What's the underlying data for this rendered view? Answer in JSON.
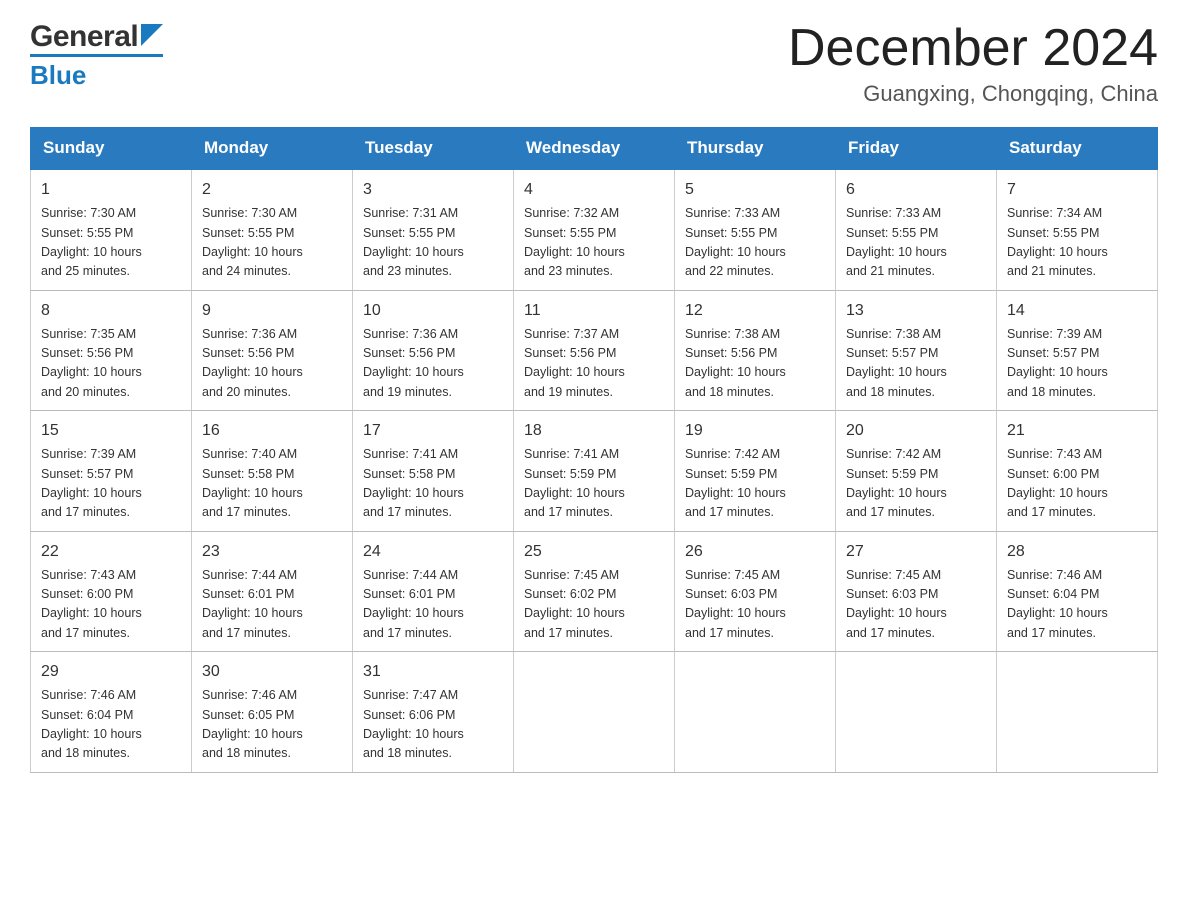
{
  "header": {
    "logo_general": "General",
    "logo_blue": "Blue",
    "title": "December 2024",
    "subtitle": "Guangxing, Chongqing, China"
  },
  "days_of_week": [
    "Sunday",
    "Monday",
    "Tuesday",
    "Wednesday",
    "Thursday",
    "Friday",
    "Saturday"
  ],
  "weeks": [
    [
      {
        "date": "1",
        "sunrise": "7:30 AM",
        "sunset": "5:55 PM",
        "daylight": "10 hours and 25 minutes."
      },
      {
        "date": "2",
        "sunrise": "7:30 AM",
        "sunset": "5:55 PM",
        "daylight": "10 hours and 24 minutes."
      },
      {
        "date": "3",
        "sunrise": "7:31 AM",
        "sunset": "5:55 PM",
        "daylight": "10 hours and 23 minutes."
      },
      {
        "date": "4",
        "sunrise": "7:32 AM",
        "sunset": "5:55 PM",
        "daylight": "10 hours and 23 minutes."
      },
      {
        "date": "5",
        "sunrise": "7:33 AM",
        "sunset": "5:55 PM",
        "daylight": "10 hours and 22 minutes."
      },
      {
        "date": "6",
        "sunrise": "7:33 AM",
        "sunset": "5:55 PM",
        "daylight": "10 hours and 21 minutes."
      },
      {
        "date": "7",
        "sunrise": "7:34 AM",
        "sunset": "5:55 PM",
        "daylight": "10 hours and 21 minutes."
      }
    ],
    [
      {
        "date": "8",
        "sunrise": "7:35 AM",
        "sunset": "5:56 PM",
        "daylight": "10 hours and 20 minutes."
      },
      {
        "date": "9",
        "sunrise": "7:36 AM",
        "sunset": "5:56 PM",
        "daylight": "10 hours and 20 minutes."
      },
      {
        "date": "10",
        "sunrise": "7:36 AM",
        "sunset": "5:56 PM",
        "daylight": "10 hours and 19 minutes."
      },
      {
        "date": "11",
        "sunrise": "7:37 AM",
        "sunset": "5:56 PM",
        "daylight": "10 hours and 19 minutes."
      },
      {
        "date": "12",
        "sunrise": "7:38 AM",
        "sunset": "5:56 PM",
        "daylight": "10 hours and 18 minutes."
      },
      {
        "date": "13",
        "sunrise": "7:38 AM",
        "sunset": "5:57 PM",
        "daylight": "10 hours and 18 minutes."
      },
      {
        "date": "14",
        "sunrise": "7:39 AM",
        "sunset": "5:57 PM",
        "daylight": "10 hours and 18 minutes."
      }
    ],
    [
      {
        "date": "15",
        "sunrise": "7:39 AM",
        "sunset": "5:57 PM",
        "daylight": "10 hours and 17 minutes."
      },
      {
        "date": "16",
        "sunrise": "7:40 AM",
        "sunset": "5:58 PM",
        "daylight": "10 hours and 17 minutes."
      },
      {
        "date": "17",
        "sunrise": "7:41 AM",
        "sunset": "5:58 PM",
        "daylight": "10 hours and 17 minutes."
      },
      {
        "date": "18",
        "sunrise": "7:41 AM",
        "sunset": "5:59 PM",
        "daylight": "10 hours and 17 minutes."
      },
      {
        "date": "19",
        "sunrise": "7:42 AM",
        "sunset": "5:59 PM",
        "daylight": "10 hours and 17 minutes."
      },
      {
        "date": "20",
        "sunrise": "7:42 AM",
        "sunset": "5:59 PM",
        "daylight": "10 hours and 17 minutes."
      },
      {
        "date": "21",
        "sunrise": "7:43 AM",
        "sunset": "6:00 PM",
        "daylight": "10 hours and 17 minutes."
      }
    ],
    [
      {
        "date": "22",
        "sunrise": "7:43 AM",
        "sunset": "6:00 PM",
        "daylight": "10 hours and 17 minutes."
      },
      {
        "date": "23",
        "sunrise": "7:44 AM",
        "sunset": "6:01 PM",
        "daylight": "10 hours and 17 minutes."
      },
      {
        "date": "24",
        "sunrise": "7:44 AM",
        "sunset": "6:01 PM",
        "daylight": "10 hours and 17 minutes."
      },
      {
        "date": "25",
        "sunrise": "7:45 AM",
        "sunset": "6:02 PM",
        "daylight": "10 hours and 17 minutes."
      },
      {
        "date": "26",
        "sunrise": "7:45 AM",
        "sunset": "6:03 PM",
        "daylight": "10 hours and 17 minutes."
      },
      {
        "date": "27",
        "sunrise": "7:45 AM",
        "sunset": "6:03 PM",
        "daylight": "10 hours and 17 minutes."
      },
      {
        "date": "28",
        "sunrise": "7:46 AM",
        "sunset": "6:04 PM",
        "daylight": "10 hours and 17 minutes."
      }
    ],
    [
      {
        "date": "29",
        "sunrise": "7:46 AM",
        "sunset": "6:04 PM",
        "daylight": "10 hours and 18 minutes."
      },
      {
        "date": "30",
        "sunrise": "7:46 AM",
        "sunset": "6:05 PM",
        "daylight": "10 hours and 18 minutes."
      },
      {
        "date": "31",
        "sunrise": "7:47 AM",
        "sunset": "6:06 PM",
        "daylight": "10 hours and 18 minutes."
      },
      null,
      null,
      null,
      null
    ]
  ],
  "labels": {
    "sunrise": "Sunrise:",
    "sunset": "Sunset:",
    "daylight": "Daylight:"
  }
}
